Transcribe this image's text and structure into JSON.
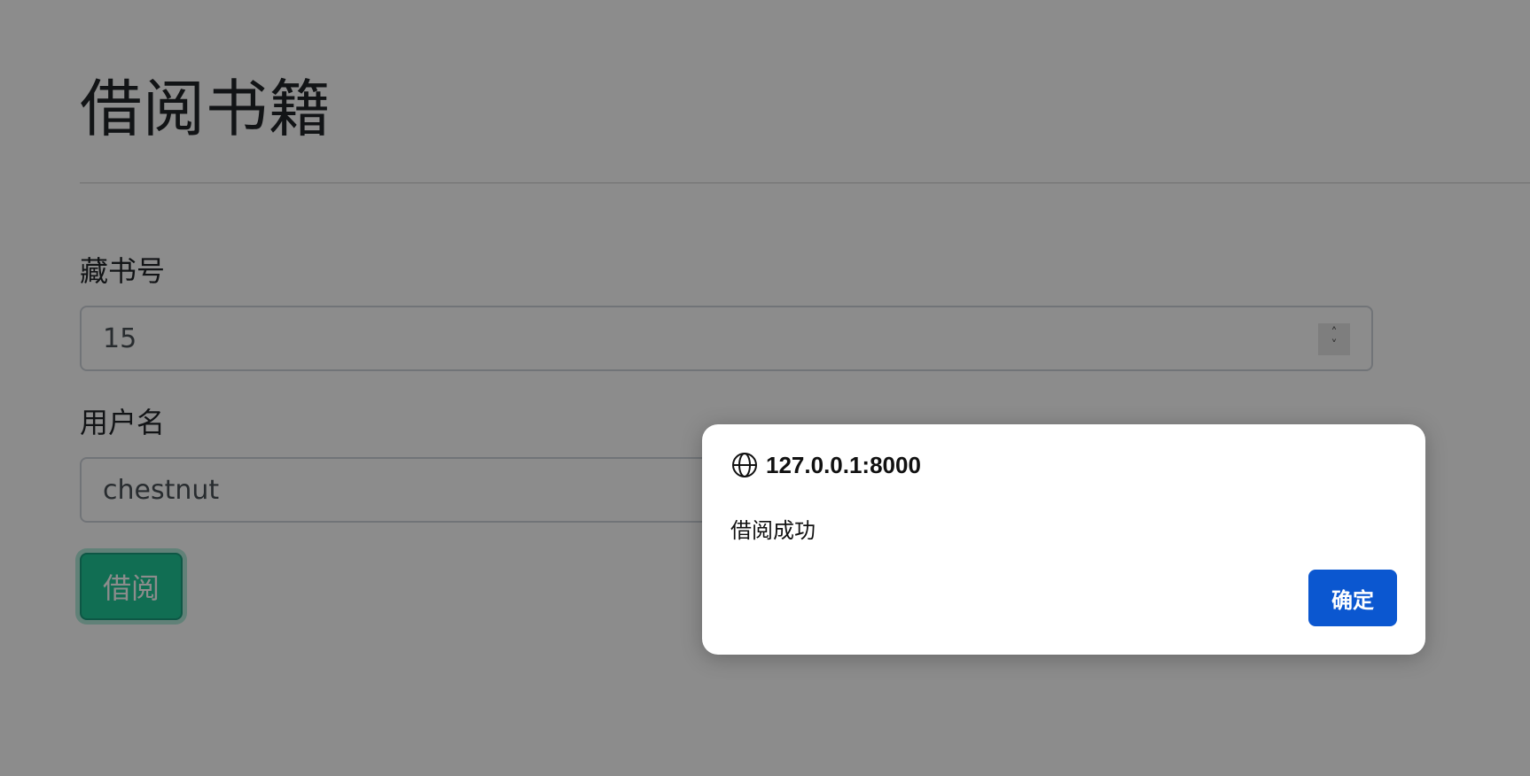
{
  "page": {
    "title": "借阅书籍",
    "book_id_label": "藏书号",
    "book_id_value": "15",
    "username_label": "用户名",
    "username_value": "chestnut",
    "borrow_button_label": "借阅"
  },
  "dialog": {
    "origin": "127.0.0.1:8000",
    "message": "借阅成功",
    "ok_label": "确定",
    "icon": "globe-icon"
  },
  "colors": {
    "borrow_button": "#20c997",
    "dialog_ok_button": "#0b57d0",
    "overlay": "rgba(0,0,0,0.45)"
  }
}
